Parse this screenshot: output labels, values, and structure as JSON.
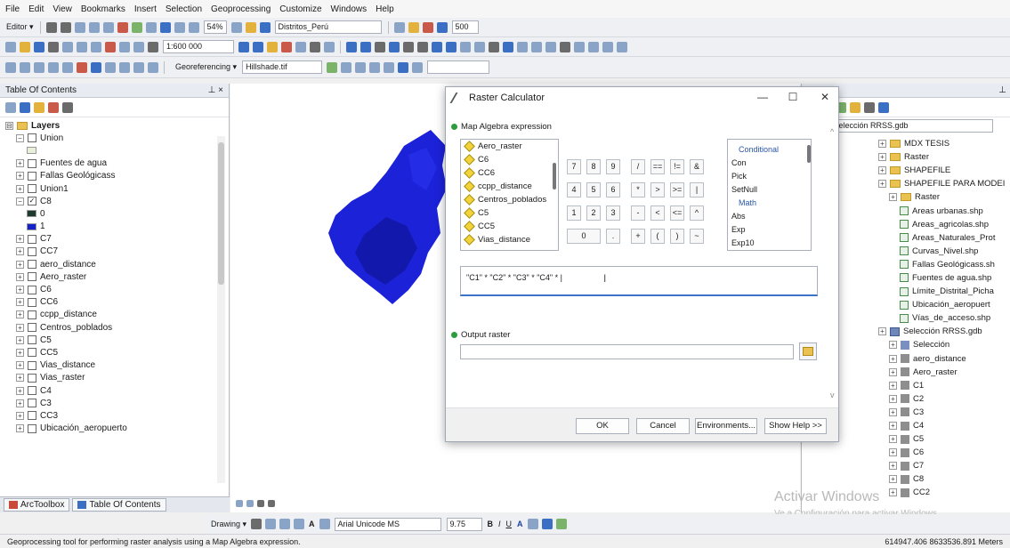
{
  "menu": [
    "File",
    "Edit",
    "View",
    "Bookmarks",
    "Insert",
    "Selection",
    "Geoprocessing",
    "Customize",
    "Windows",
    "Help"
  ],
  "toolbar1": {
    "editor": "Editor ▾",
    "zoom_pct": "54%",
    "layer_select": "Distritos_Perú",
    "num": "500"
  },
  "toolbar2": {
    "scale": "1:600 000"
  },
  "toolbar3": {
    "georef": "Georeferencing ▾",
    "georef_layer": "Hillshade.tif"
  },
  "toc": {
    "title": "Table Of Contents",
    "pin": "⊥ ×",
    "layers_label": "Layers",
    "rows": [
      {
        "indent": 1,
        "exp": "⊟",
        "chk": "",
        "label": "Union"
      },
      {
        "indent": 2,
        "swatch": "#e8f0d8",
        "label": ""
      },
      {
        "indent": 1,
        "exp": "⊞",
        "chk": "",
        "label": "Fuentes de agua"
      },
      {
        "indent": 1,
        "exp": "⊞",
        "chk": "",
        "label": "Fallas Geológicass"
      },
      {
        "indent": 1,
        "exp": "⊞",
        "chk": "",
        "label": "Union1"
      },
      {
        "indent": 1,
        "exp": "⊟",
        "chk": "✓",
        "label": "C8"
      },
      {
        "indent": 2,
        "swatch": "#1e3a2c",
        "label": "0"
      },
      {
        "indent": 2,
        "swatch": "#1422c8",
        "label": "1"
      },
      {
        "indent": 1,
        "exp": "⊞",
        "chk": "",
        "label": "C7"
      },
      {
        "indent": 1,
        "exp": "⊞",
        "chk": "",
        "label": "CC7"
      },
      {
        "indent": 1,
        "exp": "⊞",
        "chk": "",
        "label": "aero_distance"
      },
      {
        "indent": 1,
        "exp": "⊞",
        "chk": "",
        "label": "Aero_raster"
      },
      {
        "indent": 1,
        "exp": "⊞",
        "chk": "",
        "label": "C6"
      },
      {
        "indent": 1,
        "exp": "⊞",
        "chk": "",
        "label": "CC6"
      },
      {
        "indent": 1,
        "exp": "⊞",
        "chk": "",
        "label": "ccpp_distance"
      },
      {
        "indent": 1,
        "exp": "⊞",
        "chk": "",
        "label": "Centros_poblados"
      },
      {
        "indent": 1,
        "exp": "⊞",
        "chk": "",
        "label": "C5"
      },
      {
        "indent": 1,
        "exp": "⊞",
        "chk": "",
        "label": "CC5"
      },
      {
        "indent": 1,
        "exp": "⊞",
        "chk": "",
        "label": "Vias_distance"
      },
      {
        "indent": 1,
        "exp": "⊞",
        "chk": "",
        "label": "Vias_raster"
      },
      {
        "indent": 1,
        "exp": "⊞",
        "chk": "",
        "label": "C4"
      },
      {
        "indent": 1,
        "exp": "⊞",
        "chk": "",
        "label": "C3"
      },
      {
        "indent": 1,
        "exp": "⊞",
        "chk": "",
        "label": "CC3"
      },
      {
        "indent": 1,
        "exp": "⊞",
        "chk": "",
        "label": "Ubicación_aeropuerto"
      }
    ]
  },
  "tabs": [
    "ArcToolbox",
    "Table Of Contents"
  ],
  "drawbar": {
    "drawing": "Drawing ▾",
    "font": "Arial Unicode MS",
    "size": "9.75",
    "b": "B",
    "i": "I",
    "u": "U",
    "a": "A"
  },
  "status": {
    "left": "Geoprocessing tool for performing raster analysis using a Map Algebra expression.",
    "right": "614947.406  8633536.891 Meters"
  },
  "catalog": {
    "location_label": "n:",
    "location": "Selección RRSS.gdb",
    "rows": [
      {
        "indent": 1,
        "icon": "folder",
        "label": "MDX TESIS"
      },
      {
        "indent": 1,
        "icon": "folder",
        "label": "Raster"
      },
      {
        "indent": 1,
        "icon": "folder",
        "label": "SHAPEFILE"
      },
      {
        "indent": 1,
        "icon": "folder",
        "label": "SHAPEFILE PARA MODEI"
      },
      {
        "indent": 2,
        "icon": "folder",
        "label": "Raster"
      },
      {
        "indent": 3,
        "icon": "shp",
        "label": "Areas urbanas.shp"
      },
      {
        "indent": 3,
        "icon": "shp",
        "label": "Areas_agricolas.shp"
      },
      {
        "indent": 3,
        "icon": "shp",
        "label": "Areas_Naturales_Prot"
      },
      {
        "indent": 3,
        "icon": "shp",
        "label": "Curvas_Nivel.shp"
      },
      {
        "indent": 3,
        "icon": "shp",
        "label": "Fallas Geológicass.sh"
      },
      {
        "indent": 3,
        "icon": "shp",
        "label": "Fuentes de agua.shp"
      },
      {
        "indent": 3,
        "icon": "shp",
        "label": "Límite_Distrital_Picha"
      },
      {
        "indent": 3,
        "icon": "shp",
        "label": "Ubicación_aeropuert"
      },
      {
        "indent": 3,
        "icon": "shp",
        "label": "Vías_de_acceso.shp"
      },
      {
        "indent": 1,
        "icon": "gdb",
        "label": "Selección RRSS.gdb"
      },
      {
        "indent": 2,
        "icon": "tbl",
        "label": "Selección"
      },
      {
        "indent": 2,
        "icon": "rast",
        "label": "aero_distance"
      },
      {
        "indent": 2,
        "icon": "rast",
        "label": "Aero_raster"
      },
      {
        "indent": 2,
        "icon": "rast",
        "label": "C1"
      },
      {
        "indent": 2,
        "icon": "rast",
        "label": "C2"
      },
      {
        "indent": 2,
        "icon": "rast",
        "label": "C3"
      },
      {
        "indent": 2,
        "icon": "rast",
        "label": "C4"
      },
      {
        "indent": 2,
        "icon": "rast",
        "label": "C5"
      },
      {
        "indent": 2,
        "icon": "rast",
        "label": "C6"
      },
      {
        "indent": 2,
        "icon": "rast",
        "label": "C7"
      },
      {
        "indent": 2,
        "icon": "rast",
        "label": "C8"
      },
      {
        "indent": 2,
        "icon": "rast",
        "label": "CC2"
      }
    ]
  },
  "watermark": {
    "line1": "Activar Windows",
    "line2": "Ve a Configuración para activar Windows."
  },
  "dialog": {
    "title": "Raster Calculator",
    "section1": "Map Algebra expression",
    "layers": [
      "Aero_raster",
      "C6",
      "CC6",
      "ccpp_distance",
      "Centros_poblados",
      "C5",
      "CC5",
      "Vias_distance"
    ],
    "keys": [
      [
        "7",
        "8",
        "9",
        "/",
        "==",
        "!=",
        "&"
      ],
      [
        "4",
        "5",
        "6",
        "*",
        ">",
        ">=",
        "|"
      ],
      [
        "1",
        "2",
        "3",
        "-",
        "<",
        "<=",
        "^"
      ],
      [
        "0",
        ".",
        "+",
        "(",
        ")",
        "~"
      ]
    ],
    "functions": [
      {
        "head": true,
        "label": "Conditional"
      },
      {
        "label": "Con"
      },
      {
        "label": "Pick"
      },
      {
        "label": "SetNull"
      },
      {
        "head": true,
        "label": "Math"
      },
      {
        "label": "Abs"
      },
      {
        "label": "Exp"
      },
      {
        "label": "Exp10"
      }
    ],
    "expression": "\"C1\" * \"C2\" * \"C3\" * \"C4\" * |",
    "section2": "Output raster",
    "output_value": "",
    "buttons": {
      "ok": "OK",
      "cancel": "Cancel",
      "env": "Environments...",
      "help": "Show Help >>"
    }
  }
}
